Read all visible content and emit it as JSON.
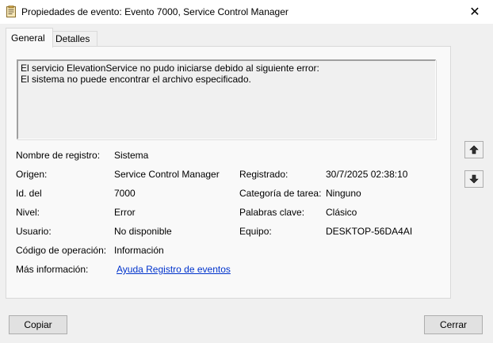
{
  "window": {
    "title": "Propiedades de evento: Evento 7000, Service Control Manager",
    "close_glyph": "✕"
  },
  "tabs": [
    {
      "label": "General",
      "active": true
    },
    {
      "label": "Detalles",
      "active": false
    }
  ],
  "description": {
    "line1": "El servicio ElevationService no pudo iniciarse debido al siguiente error:",
    "line2": "El sistema no puede encontrar el archivo especificado."
  },
  "fields": {
    "log_name": {
      "label": "Nombre de registro:",
      "value": "Sistema"
    },
    "source": {
      "label": "Origen:",
      "value": "Service Control Manager"
    },
    "logged": {
      "label": "Registrado:",
      "value": "30/7/2025 02:38:10"
    },
    "event_id": {
      "label": "Id. del",
      "value": "7000"
    },
    "task_category": {
      "label": "Categoría de tarea:",
      "value": "Ninguno"
    },
    "level": {
      "label": "Nivel:",
      "value": "Error"
    },
    "keywords": {
      "label": "Palabras clave:",
      "value": "Clásico"
    },
    "user": {
      "label": "Usuario:",
      "value": "No disponible"
    },
    "computer": {
      "label": "Equipo:",
      "value": "DESKTOP-56DA4AI"
    },
    "opcode": {
      "label": "Código de operación:",
      "value": "Información"
    },
    "more_info": {
      "label": "Más información:",
      "link": "Ayuda Registro de eventos"
    }
  },
  "buttons": {
    "copy": "Copiar",
    "close": "Cerrar"
  },
  "icons": {
    "app": "event-properties-icon",
    "up": "arrow-up-icon",
    "down": "arrow-down-icon"
  }
}
